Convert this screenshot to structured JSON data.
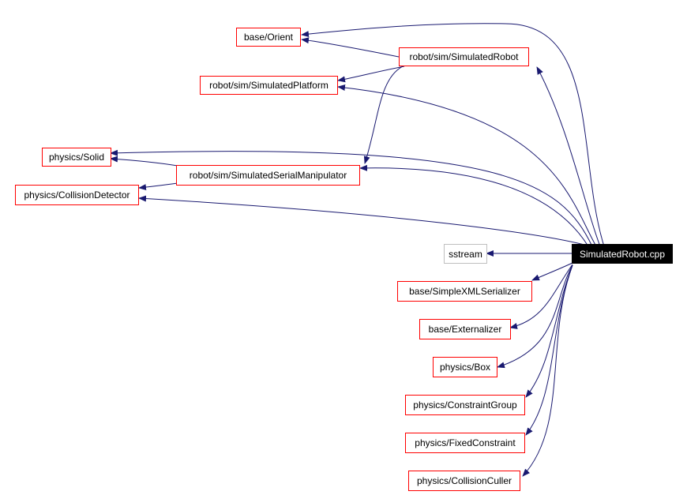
{
  "diagram": {
    "type": "include-dependency-graph",
    "root": {
      "label": "SimulatedRobot.cpp"
    },
    "nodes": {
      "orient": "base/Orient",
      "simrobot": "robot/sim/SimulatedRobot",
      "simplatform": "robot/sim/SimulatedPlatform",
      "solid": "physics/Solid",
      "simserial": "robot/sim/SimulatedSerialManipulator",
      "colldet": "physics/CollisionDetector",
      "sstream": "sstream",
      "xmlser": "base/SimpleXMLSerializer",
      "extern": "base/Externalizer",
      "box": "physics/Box",
      "cgroup": "physics/ConstraintGroup",
      "fixed": "physics/FixedConstraint",
      "culler": "physics/CollisionCuller"
    },
    "edges": [
      [
        "root",
        "orient"
      ],
      [
        "root",
        "simrobot"
      ],
      [
        "root",
        "simplatform"
      ],
      [
        "root",
        "solid"
      ],
      [
        "root",
        "simserial"
      ],
      [
        "root",
        "colldet"
      ],
      [
        "root",
        "sstream"
      ],
      [
        "root",
        "xmlser"
      ],
      [
        "root",
        "extern"
      ],
      [
        "root",
        "box"
      ],
      [
        "root",
        "cgroup"
      ],
      [
        "root",
        "fixed"
      ],
      [
        "root",
        "culler"
      ],
      [
        "simrobot",
        "orient"
      ],
      [
        "simrobot",
        "simplatform"
      ],
      [
        "simrobot",
        "simserial"
      ],
      [
        "simserial",
        "solid"
      ],
      [
        "simserial",
        "colldet"
      ]
    ],
    "colors": {
      "edge": "#191970",
      "node_border": "#ff0000",
      "external_border": "#bfbfbf",
      "root_bg": "#000000"
    }
  }
}
